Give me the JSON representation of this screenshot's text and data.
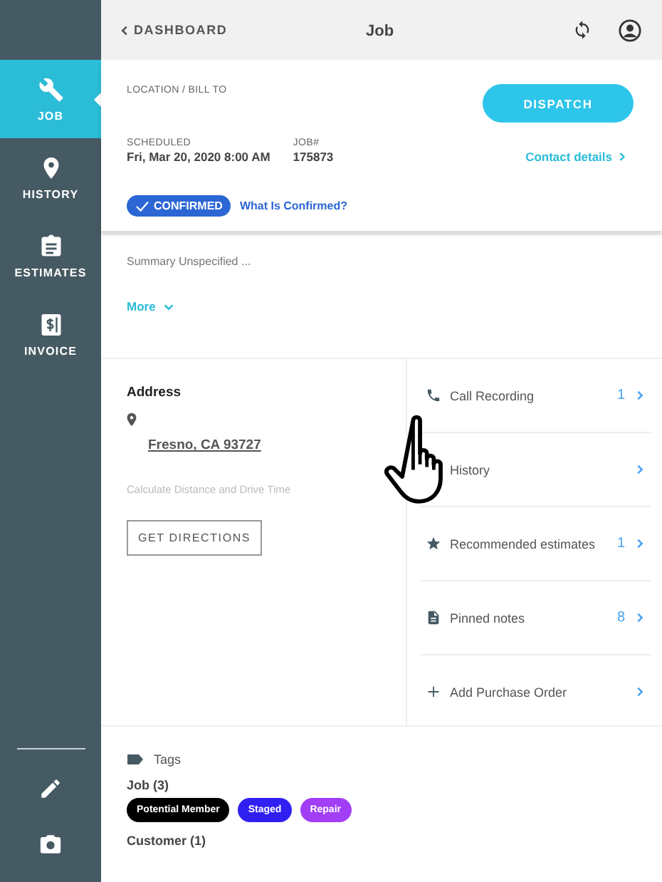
{
  "sidebar": {
    "items": [
      {
        "label": "JOB",
        "selected": true
      },
      {
        "label": "HISTORY",
        "selected": false
      },
      {
        "label": "ESTIMATES",
        "selected": false
      },
      {
        "label": "INVOICE",
        "selected": false
      }
    ]
  },
  "header": {
    "back": "DASHBOARD",
    "title": "Job"
  },
  "job_card": {
    "location_label": "LOCATION / BILL TO",
    "dispatch": "DISPATCH",
    "scheduled_label": "SCHEDULED",
    "scheduled": "Fri, Mar 20, 2020 8:00 AM",
    "job_label": "JOB#",
    "job_number": "175873",
    "contact": "Contact details",
    "status": "CONFIRMED",
    "status_link": "What Is Confirmed?"
  },
  "summary": {
    "text": "Summary Unspecified ...",
    "more": "More"
  },
  "address": {
    "title": "Address",
    "city": "Fresno, CA 93727",
    "calc": "Calculate Distance and Drive Time",
    "directions": "GET DIRECTIONS"
  },
  "links": [
    {
      "label": "Call Recording",
      "count": "1"
    },
    {
      "label": "History"
    },
    {
      "label": "Recommended estimates",
      "count": "1"
    },
    {
      "label": "Pinned notes",
      "count": "8"
    },
    {
      "label": "Add Purchase Order"
    }
  ],
  "tags": {
    "title": "Tags",
    "groups": [
      {
        "label": "Job (3)",
        "tags": [
          {
            "label": "Potential Member",
            "color": "#000000"
          },
          {
            "label": "Staged",
            "color": "#2f1ff0"
          },
          {
            "label": "Repair",
            "color": "#a23ef5"
          }
        ]
      },
      {
        "label": "Customer (1)"
      }
    ]
  }
}
